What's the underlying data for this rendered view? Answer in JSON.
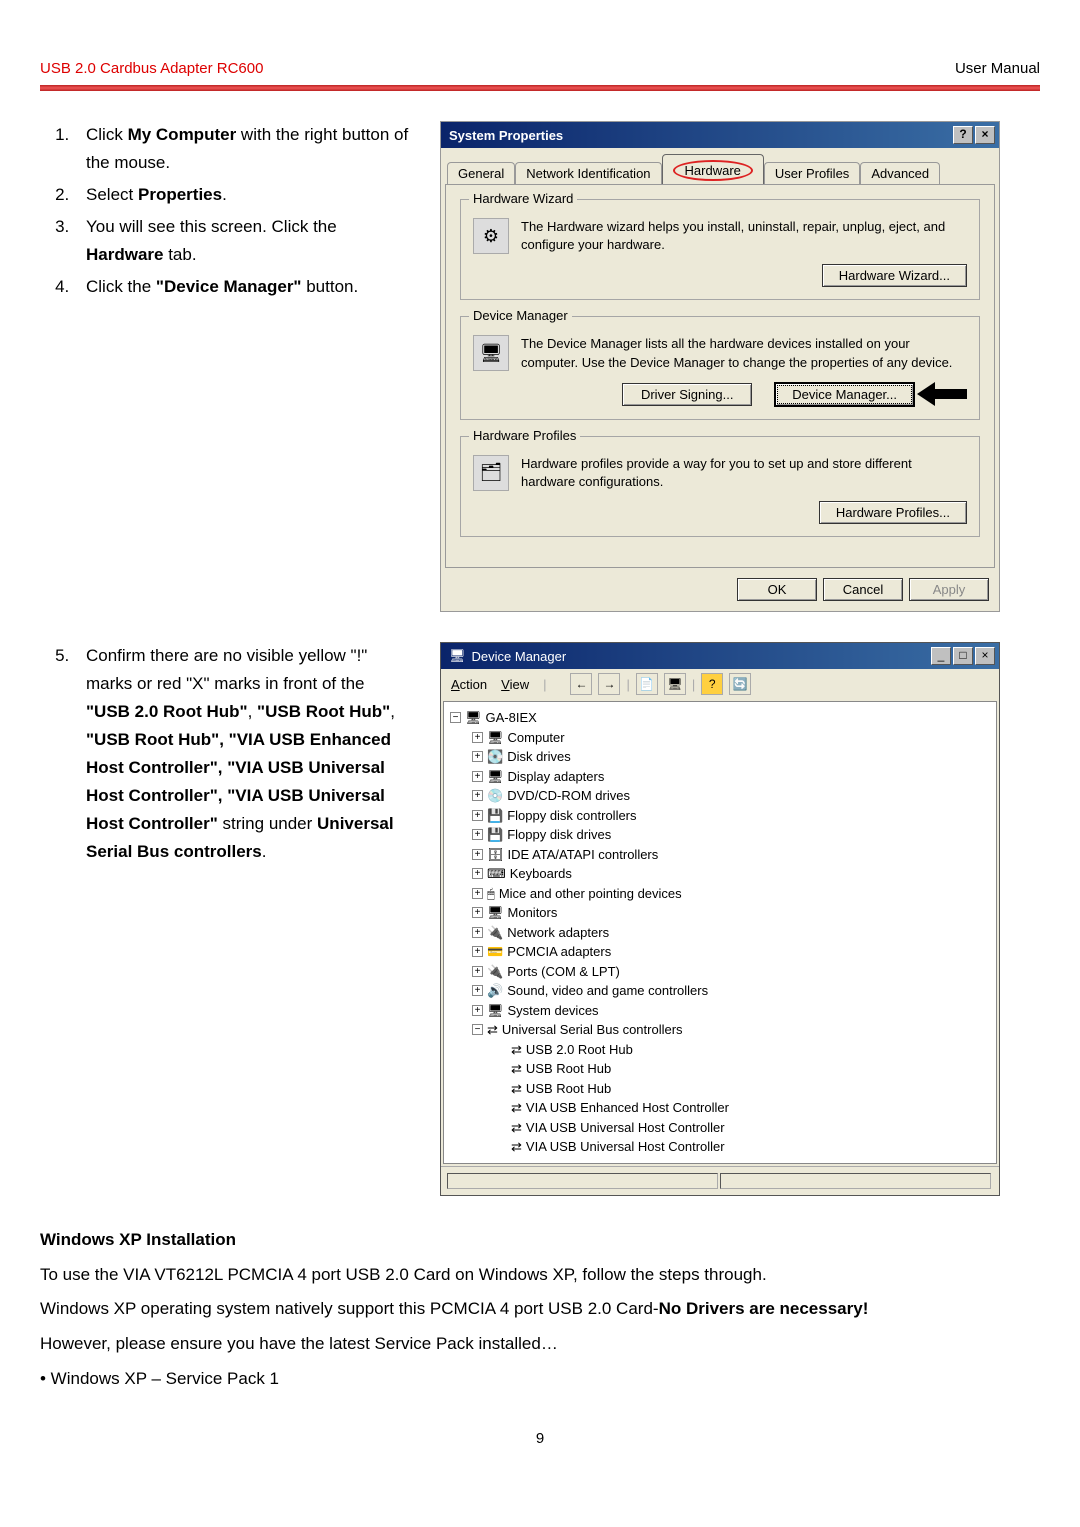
{
  "header": {
    "left": "USB 2.0 Cardbus Adapter RC600",
    "right": "User Manual"
  },
  "steps1": {
    "s1a": "Click ",
    "s1b": "My Computer",
    "s1c": " with the right button of the mouse.",
    "s2a": "Select ",
    "s2b": "Properties",
    "s2c": ".",
    "s3a": "You will see this screen. Click the ",
    "s3b": "Hardware",
    "s3c": " tab.",
    "s4a": "Click the ",
    "s4b": "\"Device Manager\"",
    "s4c": " button."
  },
  "sysprops": {
    "title": "System Properties",
    "help": "?",
    "close": "×",
    "tabs": {
      "general": "General",
      "netid": "Network Identification",
      "hw": "Hardware",
      "profiles": "User Profiles",
      "adv": "Advanced"
    },
    "hwwiz": {
      "title": "Hardware Wizard",
      "text": "The Hardware wizard helps you install, uninstall, repair, unplug, eject, and configure your hardware.",
      "button": "Hardware Wizard..."
    },
    "devmgr": {
      "title": "Device Manager",
      "text": "The Device Manager lists all the hardware devices installed on your computer. Use the Device Manager to change the properties of any device.",
      "btn_sign": "Driver Signing...",
      "btn_dm": "Device Manager..."
    },
    "hwprof": {
      "title": "Hardware Profiles",
      "text": "Hardware profiles provide a way for you to set up and store different hardware configurations.",
      "button": "Hardware Profiles..."
    },
    "footer": {
      "ok": "OK",
      "cancel": "Cancel",
      "apply": "Apply"
    }
  },
  "steps2": {
    "s5a": "Confirm there are no visible yellow \"!\" marks or red \"X\" marks in front of the ",
    "s5b": "\"USB 2.0 Root Hub\"",
    "s5c": ", ",
    "s5d": "\"USB Root Hub\"",
    "s5e": ", ",
    "s5f": "\"USB Root Hub\", \"VIA USB Enhanced Host Controller\", \"VIA USB Universal Host Controller\", \"VIA USB Universal Host Controller\"",
    "s5g": " string under ",
    "s5h": "Universal Serial Bus controllers",
    "s5i": "."
  },
  "devmgr_win": {
    "title": "Device Manager",
    "min": "_",
    "max": "□",
    "close": "×",
    "menu": {
      "action": "Action",
      "view": "View"
    },
    "root": "GA-8IEX",
    "items": [
      "Computer",
      "Disk drives",
      "Display adapters",
      "DVD/CD-ROM drives",
      "Floppy disk controllers",
      "Floppy disk drives",
      "IDE ATA/ATAPI controllers",
      "Keyboards",
      "Mice and other pointing devices",
      "Monitors",
      "Network adapters",
      "PCMCIA adapters",
      "Ports (COM & LPT)",
      "Sound, video and game controllers",
      "System devices"
    ],
    "usb_parent": "Universal Serial Bus controllers",
    "usb_children": [
      "USB 2.0 Root Hub",
      "USB Root Hub",
      "USB Root Hub",
      "VIA USB Enhanced Host Controller",
      "VIA USB Universal Host Controller",
      "VIA USB Universal Host Controller"
    ]
  },
  "bottom": {
    "heading": "Windows XP Installation",
    "p1": "To use the VIA VT6212L PCMCIA 4 port USB 2.0 Card on Windows XP, follow the steps through.",
    "p2a": "Windows XP operating system natively support this PCMCIA 4 port USB 2.0 Card-",
    "p2b": "No Drivers are necessary!",
    "p3": "However, please ensure you have the latest Service Pack installed…",
    "p4": "• Windows XP – Service Pack 1"
  },
  "page_num": "9"
}
